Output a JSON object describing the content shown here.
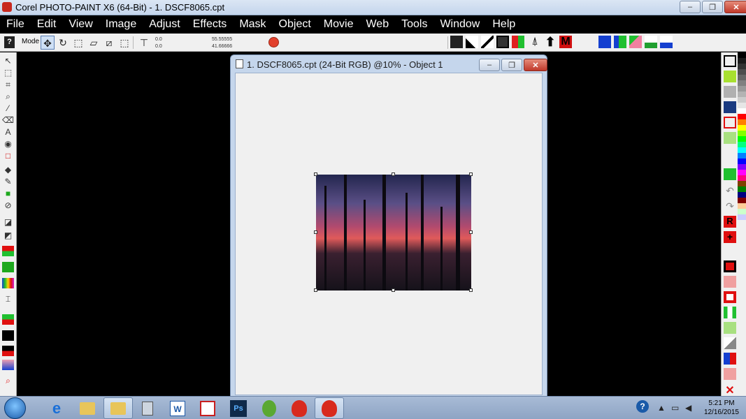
{
  "app": {
    "title": "Corel PHOTO-PAINT X6 (64-Bit) - 1. DSCF8065.cpt",
    "window_buttons": {
      "minimize": "–",
      "restore": "❐",
      "close": "✕"
    }
  },
  "menu": [
    "File",
    "Edit",
    "View",
    "Image",
    "Adjust",
    "Effects",
    "Mask",
    "Object",
    "Movie",
    "Web",
    "Tools",
    "Window",
    "Help"
  ],
  "options": {
    "help": "?",
    "mode_label": "Mode",
    "pos_x": "0.0",
    "pos_y": "0.0",
    "width": "55.55555",
    "height": "41.66666"
  },
  "document": {
    "title": "1. DSCF8065.cpt (24-Bit RGB) @10% - Object 1",
    "window_buttons": {
      "minimize": "–",
      "restore": "❐",
      "close": "✕"
    }
  },
  "taskbar": {
    "apps": [
      {
        "name": "internet-explorer",
        "label": "e"
      },
      {
        "name": "file-explorer-a",
        "label": ""
      },
      {
        "name": "file-explorer-b",
        "label": ""
      },
      {
        "name": "calculator",
        "label": ""
      },
      {
        "name": "word",
        "label": "W"
      },
      {
        "name": "acrobat",
        "label": ""
      },
      {
        "name": "photoshop",
        "label": "Ps"
      },
      {
        "name": "coreldraw",
        "label": ""
      },
      {
        "name": "photo-paint-a",
        "label": ""
      },
      {
        "name": "photo-paint-b",
        "label": ""
      }
    ],
    "time": "5:21 PM",
    "date": "12/16/2015"
  },
  "colors": {
    "accent": "#c8281e",
    "menubar": "#000000",
    "palette": [
      "#000000",
      "#1a1a1a",
      "#333333",
      "#4d4d4d",
      "#666666",
      "#808080",
      "#999999",
      "#b3b3b3",
      "#cccccc",
      "#e6e6e6",
      "#ffffff",
      "#ff0000",
      "#ff8000",
      "#ffff00",
      "#80ff00",
      "#00ff00",
      "#00ff80",
      "#00ffff",
      "#0080ff",
      "#0000ff",
      "#8000ff",
      "#ff00ff",
      "#ff0080",
      "#804000",
      "#008000",
      "#000080",
      "#800000",
      "#ffcc99",
      "#ccffcc",
      "#ccccff"
    ]
  }
}
